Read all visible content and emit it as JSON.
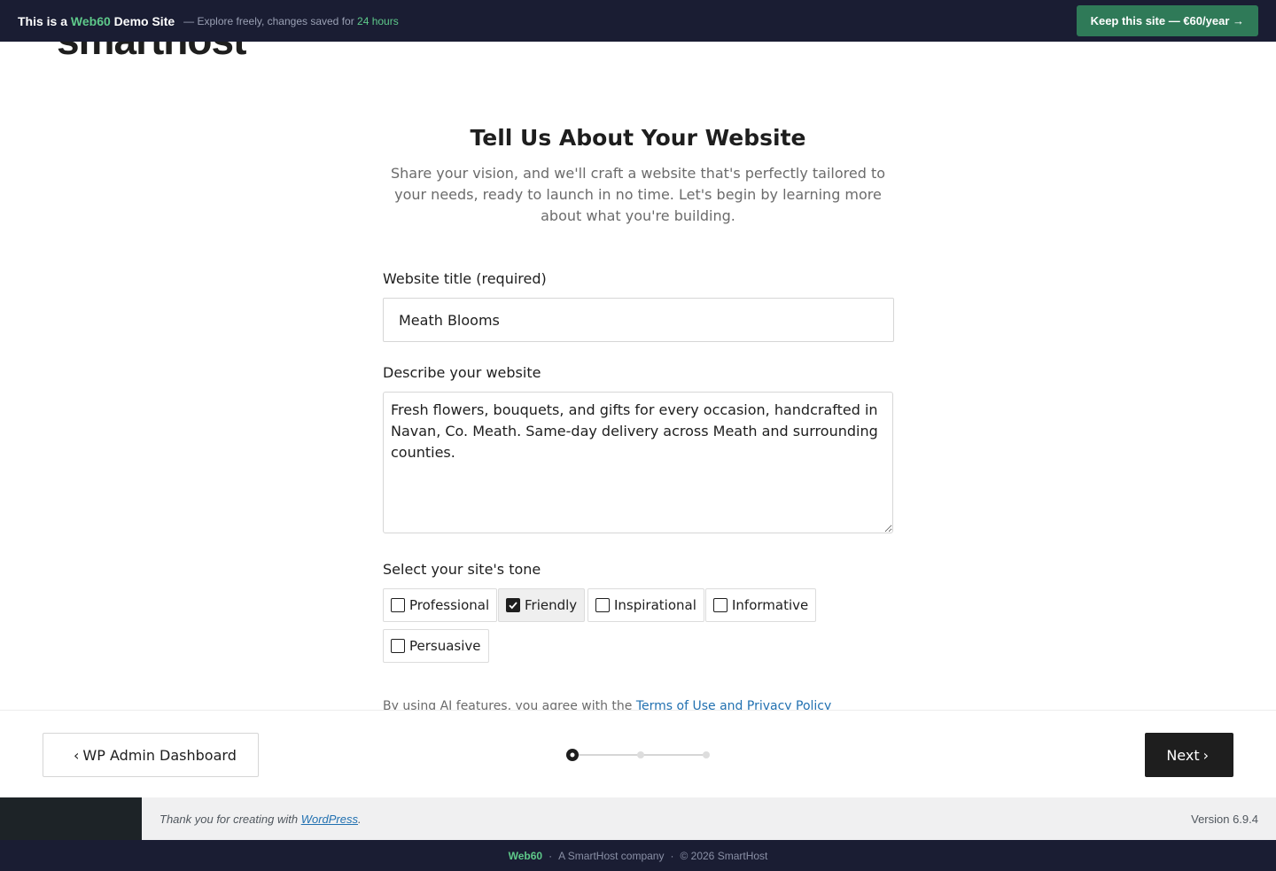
{
  "demo_banner": {
    "lead_prefix": "This is a ",
    "brand": "Web60",
    "lead_suffix": " Demo Site",
    "sub_prefix": "— Explore freely, changes saved for ",
    "sub_highlight": "24 hours",
    "keep_button": "Keep this site — €60/year →"
  },
  "logo": {
    "text": "smarthost"
  },
  "form": {
    "title": "Tell Us About Your Website",
    "description": "Share your vision, and we'll craft a website that's perfectly tailored to your needs, ready to launch in no time. Let's begin by learning more about what you're building.",
    "website_title_label": "Website title (required)",
    "website_title_value": "Meath Blooms",
    "describe_label": "Describe your website",
    "describe_value": "Fresh flowers, bouquets, and gifts for every occasion, handcrafted in Navan, Co. Meath. Same-day delivery across Meath and surrounding counties.",
    "tone_label": "Select your site's tone",
    "tones": [
      {
        "label": "Professional",
        "checked": false
      },
      {
        "label": "Friendly",
        "checked": true
      },
      {
        "label": "Inspirational",
        "checked": false
      },
      {
        "label": "Informative",
        "checked": false
      },
      {
        "label": "Persuasive",
        "checked": false
      }
    ],
    "agree_text": "By using AI features, you agree with the ",
    "agree_link": "Terms of Use and Privacy Policy"
  },
  "nav": {
    "back_label": "WP Admin Dashboard",
    "next_label": "Next",
    "steps_total": 3,
    "current_step": 1
  },
  "wp_footer": {
    "thanks_prefix": "Thank you for creating with ",
    "thanks_link": "WordPress",
    "thanks_suffix": ".",
    "version": "Version 6.9.4"
  },
  "bottom_bar": {
    "brand": "Web60",
    "company": "A SmartHost company",
    "copyright": "© 2026 SmartHost"
  },
  "colors": {
    "banner_bg": "#1a1d33",
    "accent_green": "#5ec98a",
    "keep_button_bg": "#2f7a58",
    "next_button_bg": "#1e1e1e",
    "link_blue": "#2271b1"
  }
}
